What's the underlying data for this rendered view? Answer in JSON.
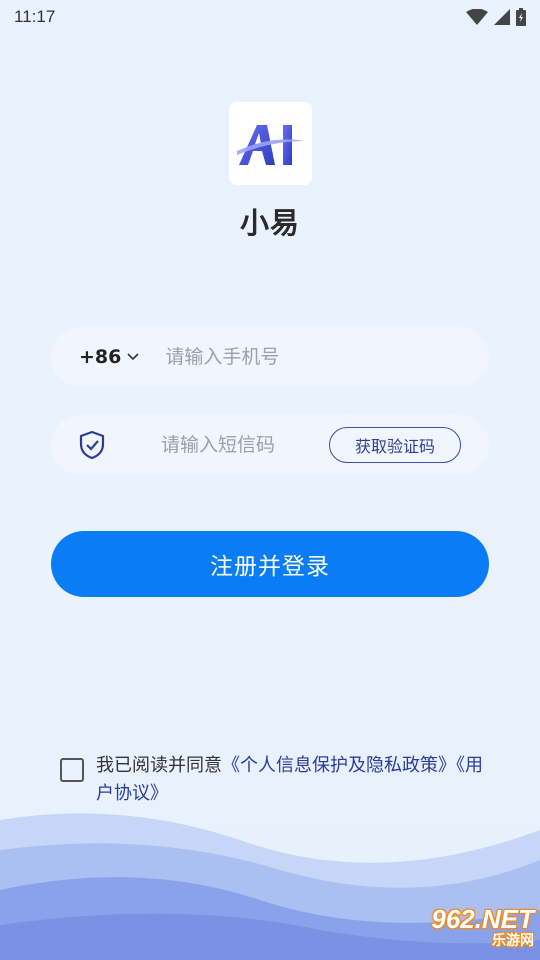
{
  "status_bar": {
    "time": "11:17",
    "icons": [
      "wifi-icon",
      "signal-icon",
      "battery-icon"
    ]
  },
  "app": {
    "logo_text": "AI",
    "name": "小易"
  },
  "login_form": {
    "country_code": "+86",
    "phone_placeholder": "请输入手机号",
    "code_placeholder": "请输入短信码",
    "get_code_label": "获取验证码",
    "submit_label": "注册并登录"
  },
  "agreement": {
    "prefix": "我已阅读并同意",
    "privacy_link": "《个人信息保护及隐私政策》",
    "user_link": "《用户协议》",
    "checked": false
  },
  "watermark": {
    "top": "962.NET",
    "bottom": "乐游网"
  },
  "colors": {
    "primary": "#0a7cf5",
    "link": "#2b3d9a",
    "background": "#e9f1fd",
    "field_bg": "#f1f5fd"
  }
}
